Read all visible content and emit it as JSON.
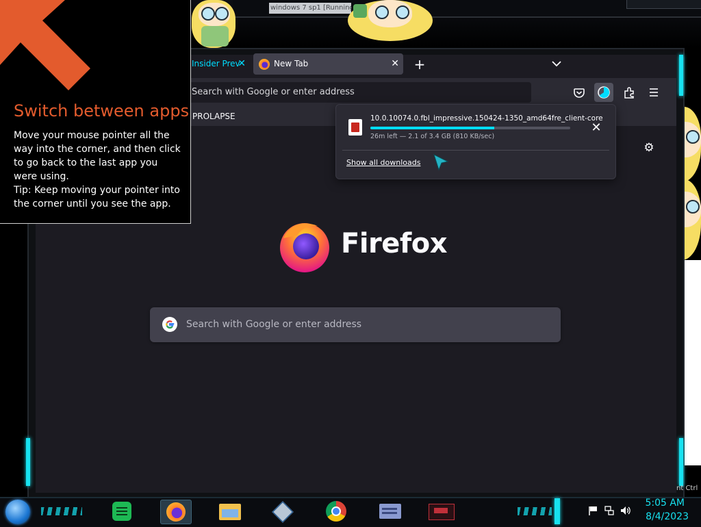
{
  "desktop": {
    "vm_title": "windows 7 sp1 [Running]"
  },
  "browser": {
    "tabs": [
      {
        "label": "Insider Prev",
        "active": false
      },
      {
        "label": "New Tab",
        "active": true
      }
    ],
    "new_tab_label": "+",
    "list_tabs_icon": "chevron-down-icon",
    "urlbar_placeholder": "Search with Google or enter address",
    "bookmark": "PROLAPSE",
    "downloads": {
      "filename": "10.0.10074.0.fbl_impressive.150424-1350_amd64fre_client-core",
      "status": "26m left — 2.1 of 3.4 GB (810 KB/sec)",
      "progress": 0.62,
      "show_all": "Show all downloads"
    },
    "new_tab_page": {
      "wordmark": "Firefox",
      "search_placeholder": "Search with Google or enter address"
    }
  },
  "tip": {
    "title": "Switch between apps",
    "body": "Move your mouse pointer all the way into the corner, and then click to go back to the last app you were using.",
    "tip": "Tip: Keep moving your pointer into the corner until you see the app."
  },
  "taskbar": {
    "apps": [
      "spotify-icon",
      "firefox-icon",
      "file-explorer-icon",
      "virtualbox-icon",
      "chrome-icon",
      "id-card-app-icon",
      "media-app-icon"
    ],
    "time": "5:05 AM",
    "date": "8/4/2023",
    "edge_text": "nt Ctrl"
  },
  "colors": {
    "accent": "#17e2f0",
    "tip_title": "#e35b2d",
    "progress": "#00ddff",
    "ff_bg": "#1c1b22"
  }
}
